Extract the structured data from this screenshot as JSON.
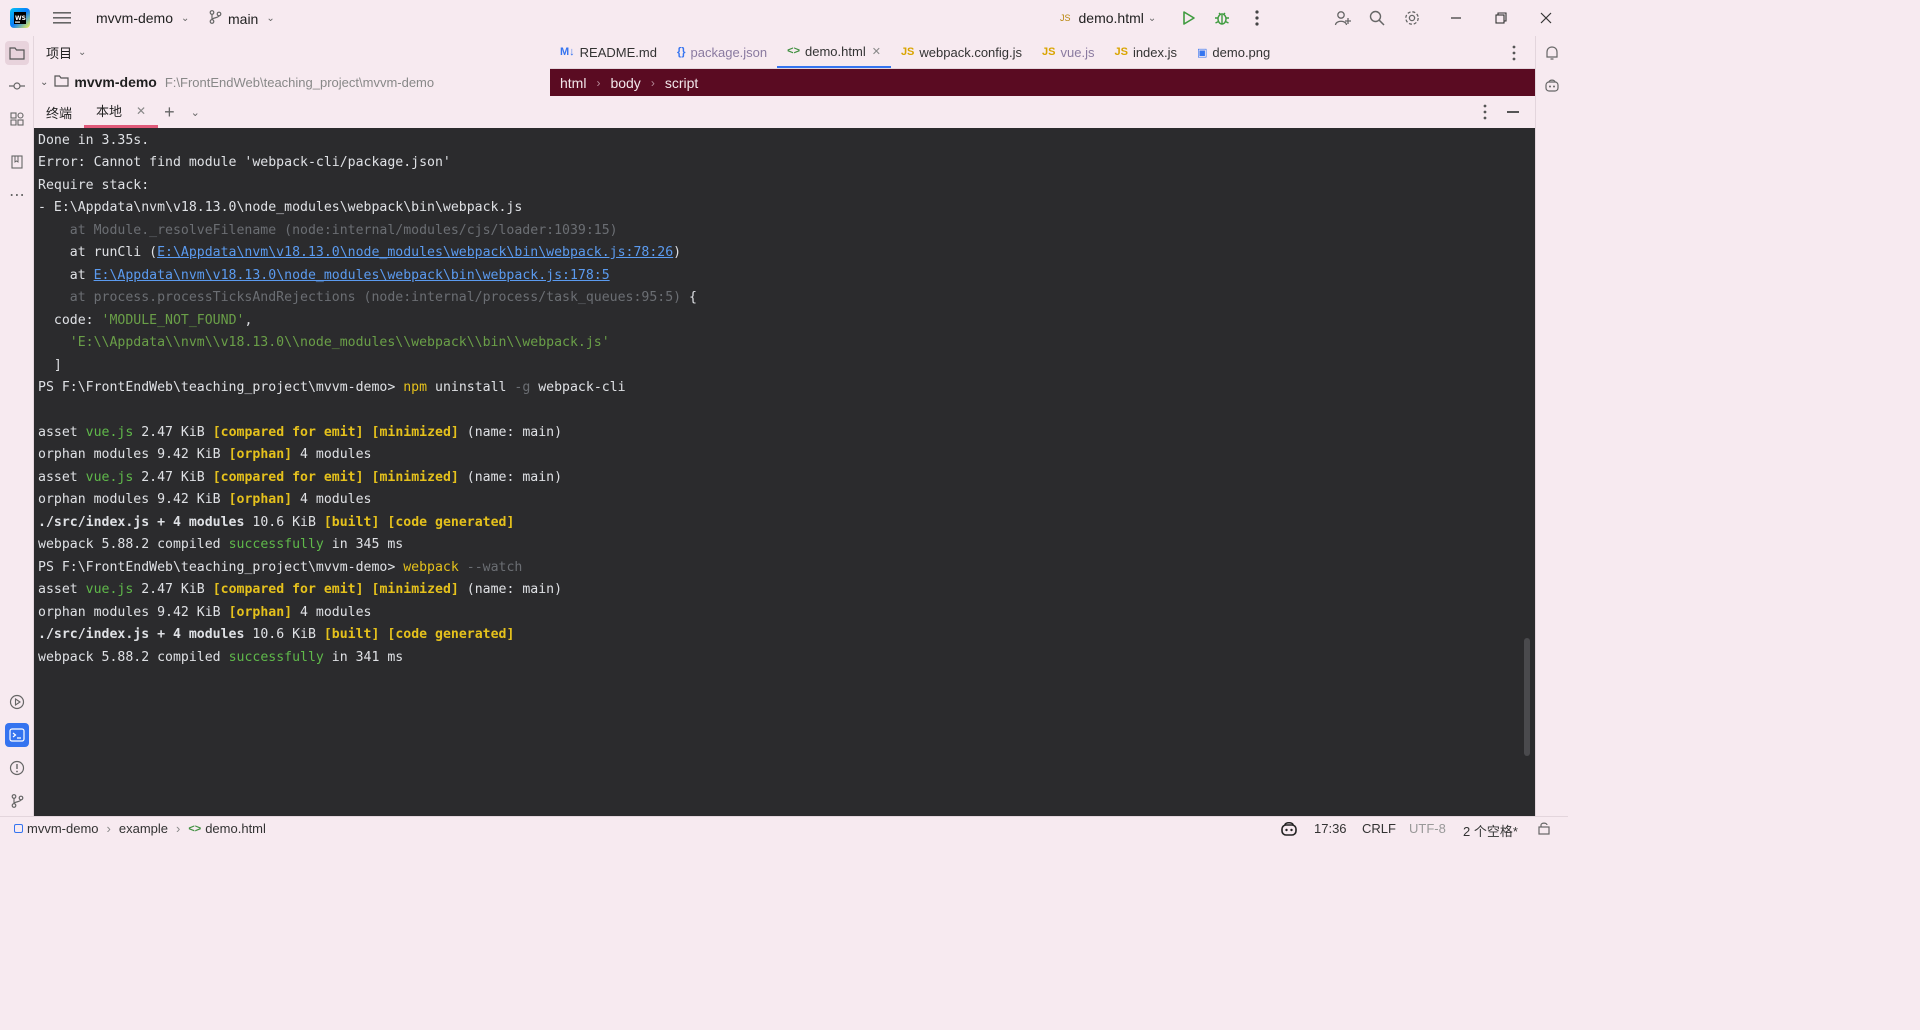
{
  "titlebar": {
    "project": "mvvm-demo",
    "branch": "main",
    "run_config": "demo.html",
    "icons": [
      "app-logo-icon",
      "hamburger-menu-icon",
      "branch-icon",
      "run-icon",
      "debug-icon",
      "more-vertical-icon",
      "add-user-icon",
      "search-icon",
      "settings-icon",
      "minimize-icon",
      "restore-icon",
      "close-icon"
    ]
  },
  "project_panel": {
    "title": "项目",
    "root_name": "mvvm-demo",
    "root_path": "F:\\FrontEndWeb\\teaching_project\\mvvm-demo"
  },
  "editor_tabs": [
    {
      "label": "README.md",
      "icon": "M↓",
      "color": "#3574f0"
    },
    {
      "label": "package.json",
      "icon": "{}",
      "color": "#3574f0"
    },
    {
      "label": "demo.html",
      "icon": "<>",
      "color": "#3f8f3f"
    },
    {
      "label": "webpack.config.js",
      "icon": "JS",
      "color": "#d9a400"
    },
    {
      "label": "vue.js",
      "icon": "JS",
      "color": "#d9a400"
    },
    {
      "label": "index.js",
      "icon": "JS",
      "color": "#d9a400"
    },
    {
      "label": "demo.png",
      "icon": "▣",
      "color": "#3574f0"
    }
  ],
  "editor_breadcrumb": [
    "html",
    "body",
    "script"
  ],
  "terminal": {
    "tab_terminal": "终端",
    "tab_local": "本地",
    "lines": {
      "l1": "Done in 3.35s.",
      "l2": "Error: Cannot find module 'webpack-cli/package.json'",
      "l3": "Require stack:",
      "l4": "- E:\\Appdata\\nvm\\v18.13.0\\node_modules\\webpack\\bin\\webpack.js",
      "l5": "    at Module._resolveFilename (node:internal/modules/cjs/loader:1039:15)",
      "l6a": "    at runCli (",
      "l6b": "E:\\Appdata\\nvm\\v18.13.0\\node_modules\\webpack\\bin\\webpack.js:78:26",
      "l6c": ")",
      "l7a": "    at ",
      "l7b": "E:\\Appdata\\nvm\\v18.13.0\\node_modules\\webpack\\bin\\webpack.js:178:5",
      "l8a": "    at process.processTicksAndRejections (node:internal/process/task_queues:95:5)",
      "l8b": " {",
      "l9a": "  code: ",
      "l9b": "'MODULE_NOT_FOUND'",
      "l9c": ",",
      "l10": "    'E:\\\\Appdata\\\\nvm\\\\v18.13.0\\\\node_modules\\\\webpack\\\\bin\\\\webpack.js'",
      "l11": "  ]",
      "prompt": "PS F:\\FrontEndWeb\\teaching_project\\mvvm-demo> ",
      "cmd1a": "npm",
      "cmd1b": " uninstall ",
      "cmd1c": "-g",
      "cmd1d": " webpack-cli",
      "asset": "asset ",
      "vuejs": "vue.js",
      "size1": " 2.47 KiB ",
      "compared": "[compared for emit]",
      "sp": " ",
      "minimized": "[minimized]",
      "name_main": " (name: main)",
      "orphan_pre": "orphan modules 9.42 KiB ",
      "orphan": "[orphan]",
      "orphan_post": " 4 modules",
      "src": "./src/index.js + 4 modules",
      "src_size": " 10.6 KiB ",
      "built": "[built]",
      "codegen": "[code generated]",
      "wp_pre": "webpack 5.88.2 compiled ",
      "success": "successfully",
      "ms1": " in 345 ms",
      "ms2": " in 341 ms",
      "cmd2a": "webpack",
      "cmd2b": " --watch"
    }
  },
  "statusbar": {
    "crumbs": [
      "mvvm-demo",
      "example",
      "demo.html"
    ],
    "time": "17:36",
    "line_sep": "CRLF",
    "encoding": "UTF-8",
    "indent": "2 个空格*"
  }
}
